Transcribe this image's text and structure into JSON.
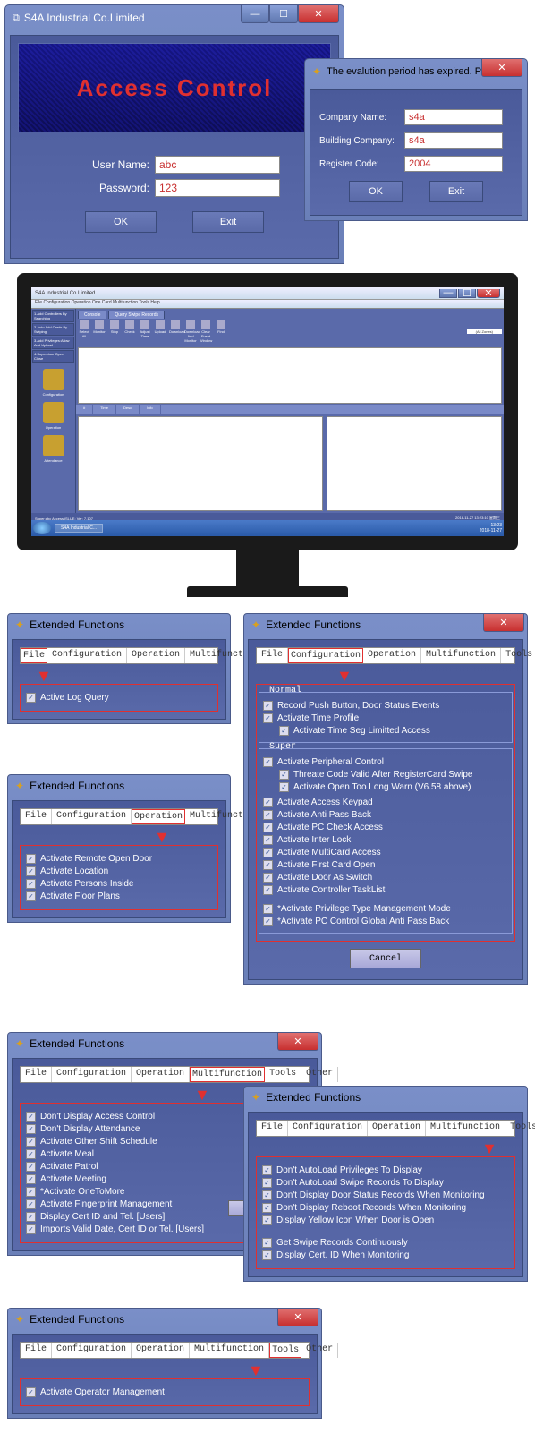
{
  "login": {
    "title": "S4A Industrial Co.Limited",
    "banner": "Access Control",
    "user_label": "User Name:",
    "pass_label": "Password:",
    "user_value": "abc",
    "pass_value": "123",
    "ok": "OK",
    "exit": "Exit"
  },
  "eval": {
    "title": "The evalution period has expired.  Please...",
    "company_label": "Company Name:",
    "company_value": "s4a",
    "building_label": "Building Company:",
    "building_value": "s4a",
    "regcode_label": "Register Code:",
    "regcode_value": "2004",
    "ok": "OK",
    "exit": "Exit"
  },
  "app": {
    "title": "S4A Industrial Co.Limited",
    "menu": "File   Configuration   Operation   One Card Multifunction   Tools   Help",
    "tabs": {
      "console": "Console",
      "query": "Query Swipe Records"
    },
    "side_tasks": [
      "1.Add Controllers By Searching",
      "2.Auto Add Cards By Swiping",
      "3.Add Privileges:Allow And Upload",
      "4.Supervisor Open Close"
    ],
    "side_icons": [
      "Configuration",
      "Operation",
      "Attendance"
    ],
    "toolbar": [
      "Select All",
      "Monitor",
      "Stop",
      "Check",
      "Adjust Time",
      "Upload",
      "Download",
      "Download And Monitor",
      "Clear Event Window",
      "Find"
    ],
    "dropdown": "(All Zones)",
    "grid_cols": [
      "#",
      "Time",
      "Desc",
      "Info"
    ],
    "status_left": "Super:abc    Access iSLUE: Ver: 7.107",
    "status_date": "2018-11-27 13:23:10 星期三",
    "task_item": "S4A Industrial C...",
    "clock": "13:23\n2018-11-27"
  },
  "ef_common": {
    "title": "Extended Functions",
    "tabs": [
      "File",
      "Configuration",
      "Operation",
      "Multifunction",
      "Tools",
      "Other"
    ],
    "cancel": "Cancel",
    "super": "Super"
  },
  "ef_file": {
    "items": [
      "Active Log Query"
    ]
  },
  "ef_operation": {
    "items": [
      "Activate Remote Open Door",
      "Activate Location",
      "Activate Persons Inside",
      "Activate Floor Plans"
    ]
  },
  "ef_config": {
    "normal_label": "Normal",
    "super_label": "Super",
    "normal": [
      {
        "t": "Record Push Button, Door Status Events",
        "i": 0
      },
      {
        "t": "Activate Time Profile",
        "i": 0
      },
      {
        "t": "Activate Time Seg Limitted Access",
        "i": 1
      }
    ],
    "super1": [
      {
        "t": "Activate Peripheral Control",
        "i": 0
      },
      {
        "t": "Threate Code Valid After RegisterCard Swipe",
        "i": 1
      },
      {
        "t": "Activate Open Too Long Warn (V6.58 above)",
        "i": 1
      }
    ],
    "super2": [
      "Activate Access Keypad",
      "Activate Anti Pass Back",
      "Activate PC Check Access",
      "Activate Inter Lock",
      "Activate MultiCard Access",
      "Activate First Card Open",
      "Activate Door As Switch",
      "Activate Controller TaskList"
    ],
    "super3": [
      "*Activate Privilege Type Management Mode",
      "*Activate PC Control Global Anti Pass Back"
    ]
  },
  "ef_multi": {
    "items": [
      "Don't Display Access Control",
      "Don't Display Attendance",
      "Activate Other Shift Schedule",
      "Activate Meal",
      "Activate Patrol",
      "Activate Meeting",
      "*Activate OneToMore",
      "Activate Fingerprint Management",
      "Display Cert ID and Tel. [Users]",
      "Imports Valid Date,  Cert ID or Tel. [Users]"
    ]
  },
  "ef_other": {
    "items1": [
      "Don't AutoLoad Privileges To Display",
      "Don't AutoLoad Swipe Records To Display",
      "Don't Display Door Status Records When Monitoring",
      "Don't Display Reboot Records When Monitoring",
      "Display Yellow Icon When Door is Open"
    ],
    "items2": [
      "Get Swipe Records Continuously",
      "Display Cert. ID When Monitoring"
    ]
  },
  "ef_tools": {
    "items": [
      "Activate Operator Management"
    ]
  }
}
